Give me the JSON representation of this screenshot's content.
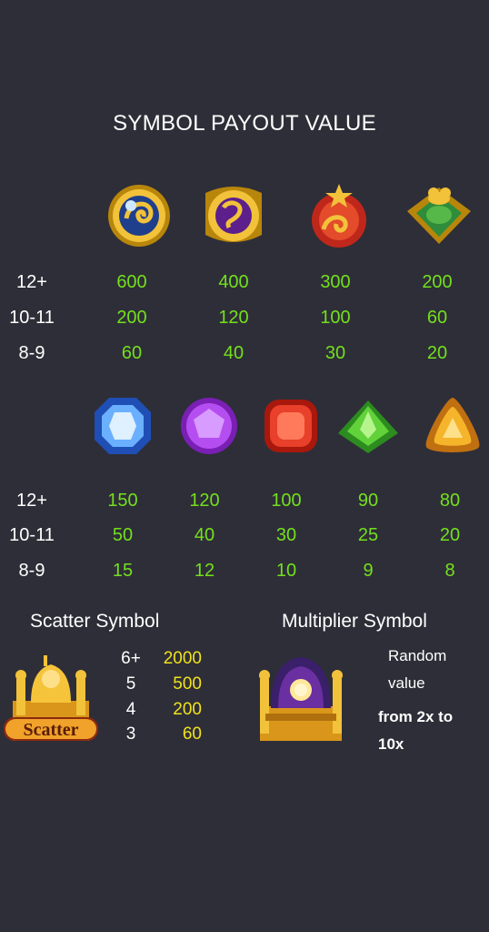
{
  "title": "SYMBOL PAYOUT VALUE",
  "high_symbols": {
    "icons": [
      "gold-blue-emblem-icon",
      "gold-purple-emblem-icon",
      "red-flower-emblem-icon",
      "green-frog-emblem-icon"
    ],
    "rows": [
      {
        "label": "12+",
        "values": [
          "600",
          "400",
          "300",
          "200"
        ]
      },
      {
        "label": "10-11",
        "values": [
          "200",
          "120",
          "100",
          "60"
        ]
      },
      {
        "label": "8-9",
        "values": [
          "60",
          "40",
          "30",
          "20"
        ]
      }
    ]
  },
  "low_symbols": {
    "icons": [
      "blue-gem-icon",
      "purple-gem-icon",
      "red-gem-icon",
      "green-gem-icon",
      "yellow-gem-icon"
    ],
    "rows": [
      {
        "label": "12+",
        "values": [
          "150",
          "120",
          "100",
          "90",
          "80"
        ]
      },
      {
        "label": "10-11",
        "values": [
          "50",
          "40",
          "30",
          "25",
          "20"
        ]
      },
      {
        "label": "8-9",
        "values": [
          "15",
          "12",
          "10",
          "9",
          "8"
        ]
      }
    ]
  },
  "scatter": {
    "title": "Scatter Symbol",
    "icon_text": "Scatter",
    "rows": [
      {
        "count": "6+",
        "value": "2000"
      },
      {
        "count": "5",
        "value": "500"
      },
      {
        "count": "4",
        "value": "200"
      },
      {
        "count": "3",
        "value": "60"
      }
    ]
  },
  "multiplier": {
    "title": "Multiplier Symbol",
    "line1": "Random",
    "line2": "value",
    "line3": "from 2x to",
    "line4": "10x"
  },
  "colors": {
    "background": "#2e2e38",
    "payout_green": "#73e01c",
    "scatter_yellow": "#f1e21c"
  }
}
